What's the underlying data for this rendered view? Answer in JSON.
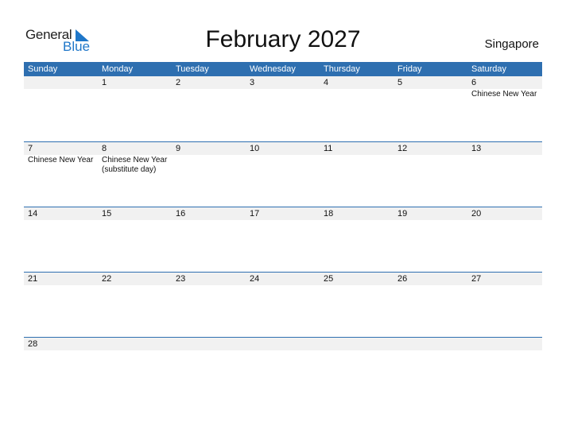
{
  "logo": {
    "word1": "General",
    "word2": "Blue"
  },
  "header": {
    "title": "February 2027",
    "country": "Singapore"
  },
  "colors": {
    "accent": "#2e6fb0",
    "logo_blue": "#1f77c9",
    "date_strip": "#f1f1f1"
  },
  "weekdays": [
    "Sunday",
    "Monday",
    "Tuesday",
    "Wednesday",
    "Thursday",
    "Friday",
    "Saturday"
  ],
  "weeks": [
    {
      "days": [
        "",
        "1",
        "2",
        "3",
        "4",
        "5",
        "6"
      ],
      "events": [
        "",
        "",
        "",
        "",
        "",
        "",
        "Chinese New Year"
      ]
    },
    {
      "days": [
        "7",
        "8",
        "9",
        "10",
        "11",
        "12",
        "13"
      ],
      "events": [
        "Chinese New Year",
        "Chinese New Year (substitute day)",
        "",
        "",
        "",
        "",
        ""
      ]
    },
    {
      "days": [
        "14",
        "15",
        "16",
        "17",
        "18",
        "19",
        "20"
      ],
      "events": [
        "",
        "",
        "",
        "",
        "",
        "",
        ""
      ]
    },
    {
      "days": [
        "21",
        "22",
        "23",
        "24",
        "25",
        "26",
        "27"
      ],
      "events": [
        "",
        "",
        "",
        "",
        "",
        "",
        ""
      ]
    },
    {
      "days": [
        "28",
        "",
        "",
        "",
        "",
        "",
        ""
      ],
      "events": [
        "",
        "",
        "",
        "",
        "",
        "",
        ""
      ]
    }
  ]
}
